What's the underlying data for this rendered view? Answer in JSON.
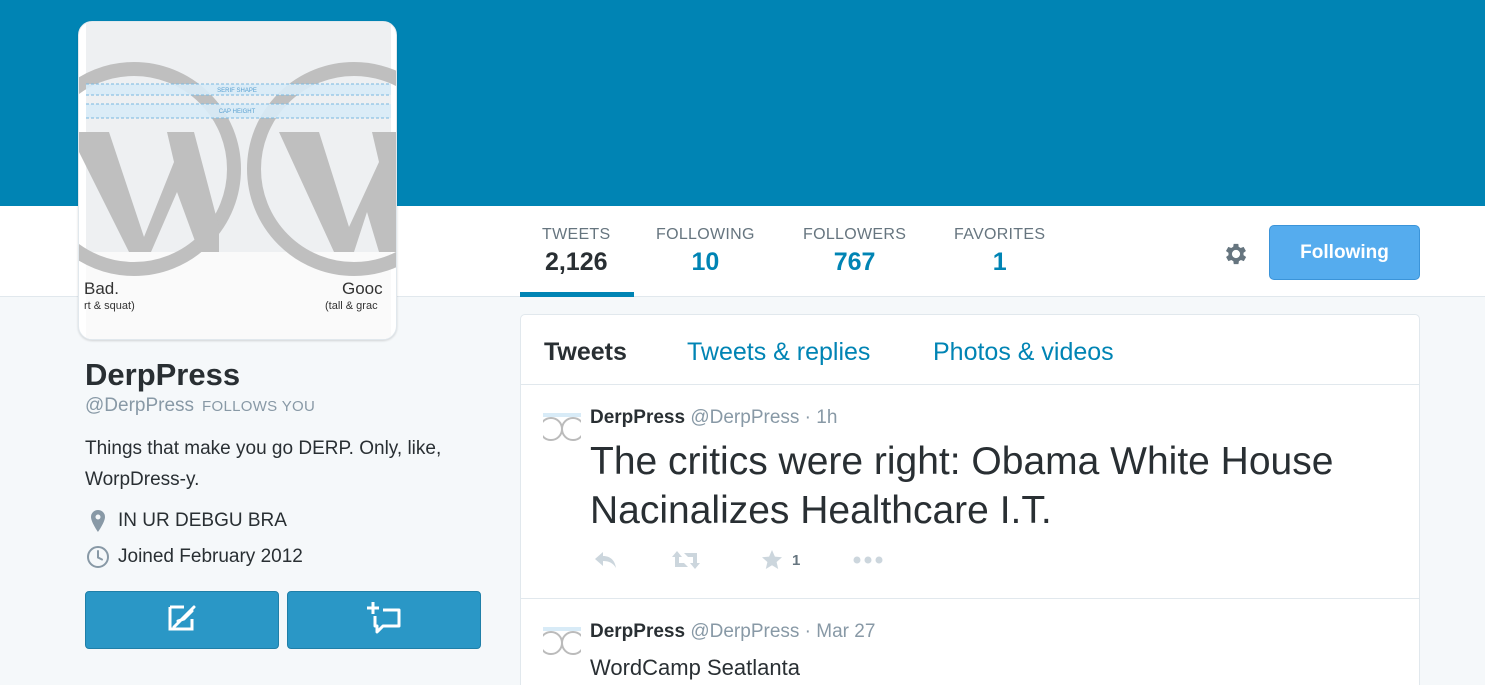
{
  "colors": {
    "header": "#0084b4",
    "link": "#0084b4",
    "button": "#55acee",
    "action_button": "#2a97c6"
  },
  "avatar": {
    "left_caption_big": "Bad.",
    "left_caption_small": "rt & squat)",
    "right_caption_big": "Gooc",
    "right_caption_small": "(tall & grac",
    "guide_top": "SERIF SHAPE",
    "guide_bottom": "CAP HEIGHT"
  },
  "stats": [
    {
      "label": "TWEETS",
      "value": "2,126"
    },
    {
      "label": "FOLLOWING",
      "value": "10"
    },
    {
      "label": "FOLLOWERS",
      "value": "767"
    },
    {
      "label": "FAVORITES",
      "value": "1"
    }
  ],
  "actions": {
    "settings_icon": "gear-icon",
    "follow_label": "Following"
  },
  "profile": {
    "name": "DerpPress",
    "handle": "@DerpPress",
    "follows_you": "FOLLOWS YOU",
    "bio": "Things that make you go DERP. Only, like, WorpDress-y.",
    "location": "IN UR DEBGU BRA",
    "joined": "Joined February 2012",
    "buttons": [
      {
        "icon": "compose-tweet-icon"
      },
      {
        "icon": "add-to-list-icon"
      }
    ]
  },
  "timeline": {
    "tabs": [
      {
        "label": "Tweets"
      },
      {
        "label": "Tweets & replies"
      },
      {
        "label": "Photos & videos"
      }
    ],
    "tweets": [
      {
        "name": "DerpPress",
        "handle": "@DerpPress",
        "separator": "·",
        "time": "1h",
        "text": "The critics were right: Obama White House Nacinalizes Healthcare I.T.",
        "favorites": "1"
      },
      {
        "name": "DerpPress",
        "handle": "@DerpPress",
        "separator": "·",
        "time": "Mar 27",
        "text": "WordCamp Seatlanta"
      }
    ]
  }
}
